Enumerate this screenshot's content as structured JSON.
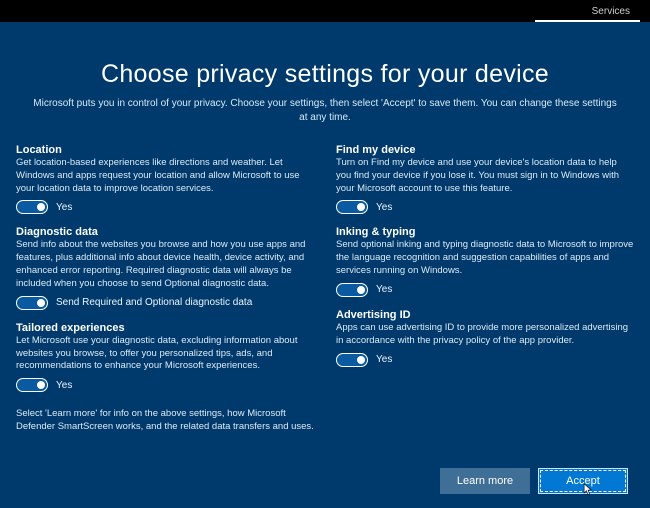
{
  "topbar": {
    "tab": "Services"
  },
  "header": {
    "title": "Choose privacy settings for your device",
    "subtitle": "Microsoft puts you in control of your privacy. Choose your settings, then select 'Accept' to save them. You can change these settings at any time."
  },
  "left": [
    {
      "title": "Location",
      "desc": "Get location-based experiences like directions and weather. Let Windows and apps request your location and allow Microsoft to use your location data to improve location services.",
      "toggle_label": "Yes"
    },
    {
      "title": "Diagnostic data",
      "desc": "Send info about the websites you browse and how you use apps and features, plus additional info about device health, device activity, and enhanced error reporting. Required diagnostic data will always be included when you choose to send Optional diagnostic data.",
      "toggle_label": "Send Required and Optional diagnostic data"
    },
    {
      "title": "Tailored experiences",
      "desc": "Let Microsoft use your diagnostic data, excluding information about websites you browse, to offer you personalized tips, ads, and recommendations to enhance your Microsoft experiences.",
      "toggle_label": "Yes"
    }
  ],
  "right": [
    {
      "title": "Find my device",
      "desc": "Turn on Find my device and use your device's location data to help you find your device if you lose it. You must sign in to Windows with your Microsoft account to use this feature.",
      "toggle_label": "Yes"
    },
    {
      "title": "Inking & typing",
      "desc": "Send optional inking and typing diagnostic data to Microsoft to improve the language recognition and suggestion capabilities of apps and services running on Windows.",
      "toggle_label": "Yes"
    },
    {
      "title": "Advertising ID",
      "desc": "Apps can use advertising ID to provide more personalized advertising in accordance with the privacy policy of the app provider.",
      "toggle_label": "Yes"
    }
  ],
  "footnote": "Select 'Learn more' for info on the above settings, how Microsoft Defender SmartScreen works, and the related data transfers and uses.",
  "footer": {
    "learn_more": "Learn more",
    "accept": "Accept"
  }
}
